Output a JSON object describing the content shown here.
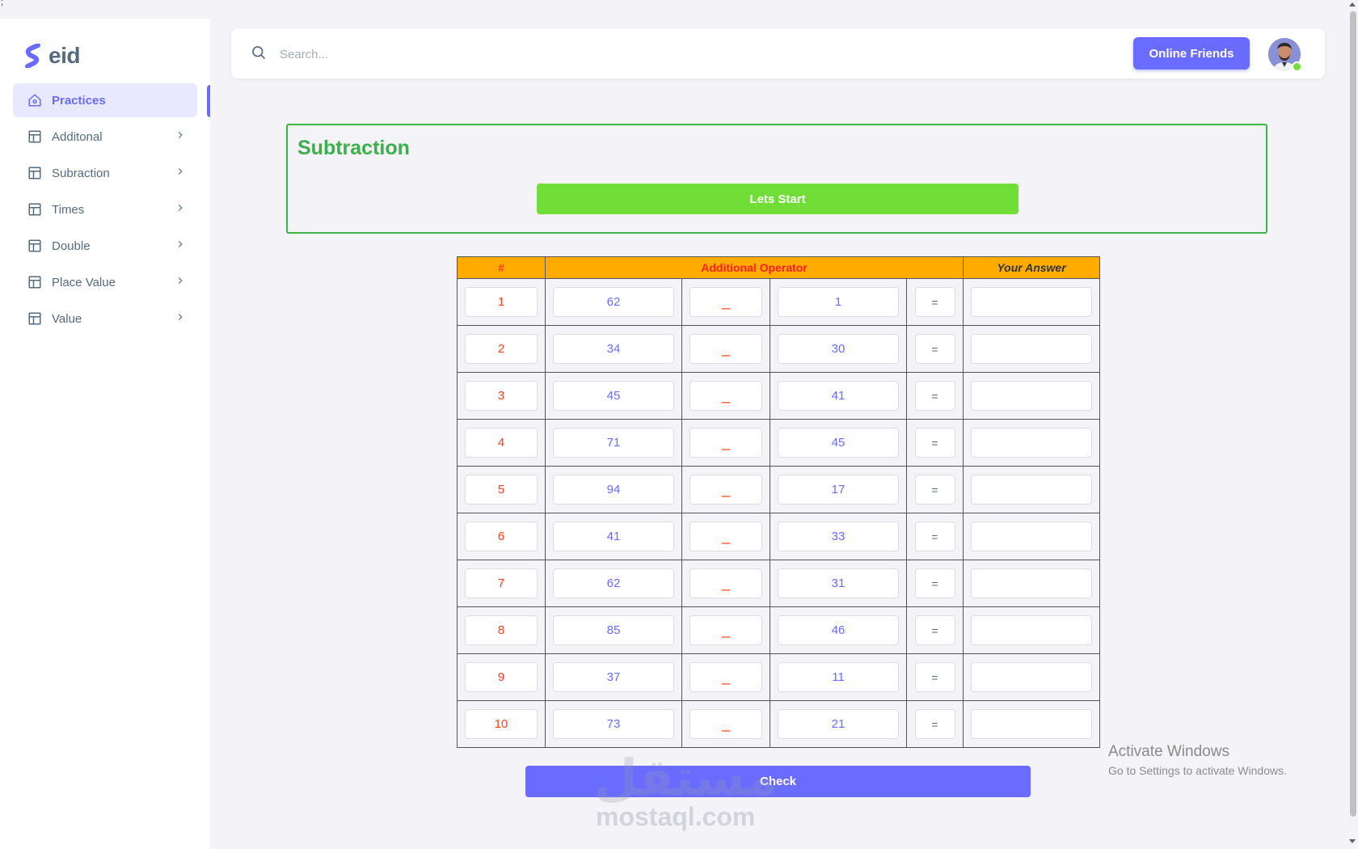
{
  "misc": {
    "top_left_glyph": ";"
  },
  "brand": {
    "name": "eid",
    "color": "#696cff"
  },
  "sidebar": {
    "items": [
      {
        "label": "Practices",
        "icon": "home-icon",
        "active": true
      },
      {
        "label": "Additonal",
        "icon": "layout-icon"
      },
      {
        "label": "Subraction",
        "icon": "layout-icon"
      },
      {
        "label": "Times",
        "icon": "layout-icon"
      },
      {
        "label": "Double",
        "icon": "layout-icon"
      },
      {
        "label": "Place Value",
        "icon": "layout-icon"
      },
      {
        "label": "Value",
        "icon": "layout-icon"
      }
    ]
  },
  "topbar": {
    "search_placeholder": "Search...",
    "online_friends_label": "Online Friends",
    "avatar_status": "online"
  },
  "card": {
    "title": "Subtraction",
    "start_label": "Lets Start"
  },
  "table": {
    "headers": {
      "num": "#",
      "operator": "Additional Operator",
      "answer": "Your Answer"
    },
    "operator_symbol": "_",
    "equals_symbol": "=",
    "rows": [
      {
        "n": "1",
        "a": "62",
        "b": "1"
      },
      {
        "n": "2",
        "a": "34",
        "b": "30"
      },
      {
        "n": "3",
        "a": "45",
        "b": "41"
      },
      {
        "n": "4",
        "a": "71",
        "b": "45"
      },
      {
        "n": "5",
        "a": "94",
        "b": "17"
      },
      {
        "n": "6",
        "a": "41",
        "b": "33"
      },
      {
        "n": "7",
        "a": "62",
        "b": "31"
      },
      {
        "n": "8",
        "a": "85",
        "b": "46"
      },
      {
        "n": "9",
        "a": "37",
        "b": "11"
      },
      {
        "n": "10",
        "a": "73",
        "b": "21"
      }
    ]
  },
  "check_label": "Check",
  "watermark": {
    "arabic": "مستقل",
    "latin": "mostaql.com"
  },
  "activation": {
    "title": "Activate Windows",
    "subtitle": "Go to Settings to activate Windows."
  },
  "colors": {
    "primary": "#696cff",
    "success": "#71dd37",
    "warning": "#ffab00",
    "danger": "#ff3e1d",
    "card_border": "#39b54a"
  }
}
